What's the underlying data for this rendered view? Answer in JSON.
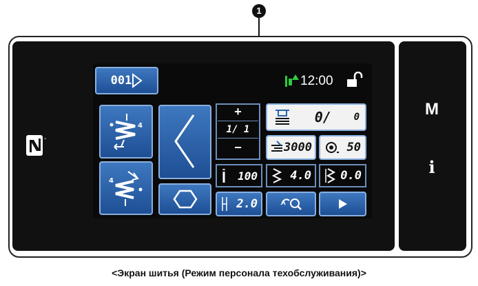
{
  "callout": {
    "number": "1"
  },
  "header": {
    "pattern_number": "001",
    "time": "12:00"
  },
  "counter": {
    "plus_label": "+",
    "value": "1/ 1",
    "minus_label": "−"
  },
  "bobbin_counter": {
    "value": "0/",
    "total": "0"
  },
  "speed": {
    "value": "3000"
  },
  "stitch_count": {
    "value": "50"
  },
  "needle_stitch": {
    "value": "100"
  },
  "stitch_width": {
    "value": "4.0"
  },
  "stitch_offset": {
    "value": "0.0"
  },
  "pitch": {
    "value": "2.0"
  },
  "side_keys": {
    "m_label": "M",
    "i_label": "i"
  },
  "caption": "<Экран шитья (Режим персонала техобслуживания)>",
  "colors": {
    "panel": "#111111",
    "button": "#2b62a8",
    "button_border": "#8ab0e0",
    "lock": "#ffffff",
    "led": "#2ecc40"
  }
}
